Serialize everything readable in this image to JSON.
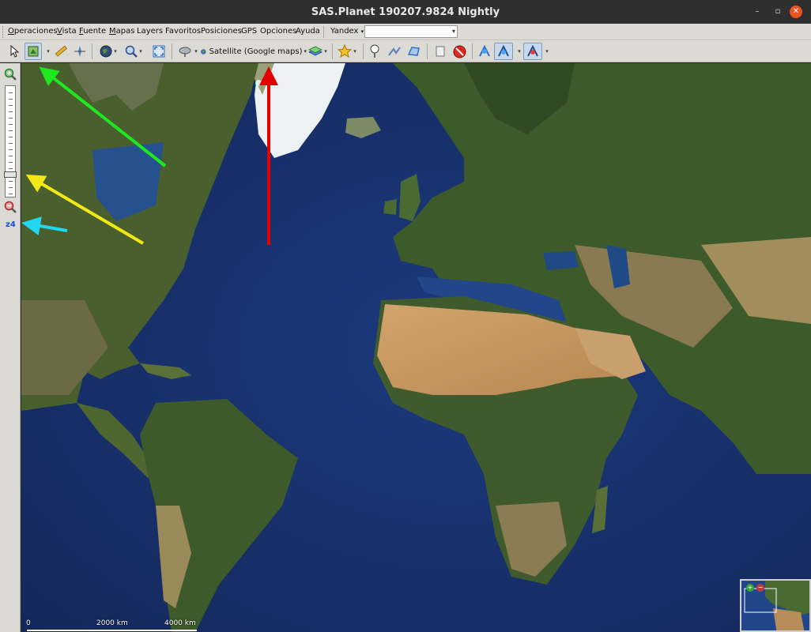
{
  "window": {
    "title": "SAS.Planet 190207.9824 Nightly",
    "minimize_glyph": "–",
    "maximize_glyph": "▫",
    "close_glyph": "✕"
  },
  "menu": {
    "items": [
      {
        "accel": "O",
        "rest": "peraciones"
      },
      {
        "accel": "V",
        "rest": "ista"
      },
      {
        "accel": "F",
        "rest": "uente"
      },
      {
        "accel": "M",
        "rest": "apas"
      },
      {
        "accel": "",
        "rest": "Layers"
      },
      {
        "accel": "",
        "rest": "Favoritos"
      },
      {
        "accel": "",
        "rest": "Posiciones"
      },
      {
        "accel": "",
        "rest": "GPS"
      },
      {
        "accel": "",
        "rest": "Opciones"
      },
      {
        "accel": "",
        "rest": "Ayuda"
      }
    ],
    "search_provider": "Yandex",
    "search_value": ""
  },
  "toolbar": {
    "map_source_label": "Satellite (Google maps)",
    "icons": [
      "cursor-icon",
      "select-region-icon",
      "ruler-icon",
      "compass-icon",
      "globe-icon",
      "zoom-lens-icon",
      "fullscreen-icon",
      "satellite-dish-icon",
      "map-source-globe-icon",
      "layers-icon",
      "favorite-star-icon",
      "placemark-icon",
      "path-icon",
      "polygon-icon",
      "label-icon",
      "stop-icon",
      "gps-connect-icon",
      "gps-track-icon",
      "gps-center-icon"
    ]
  },
  "leftpanel": {
    "zoom_level": "z4",
    "zoom_fraction": 0.82
  },
  "scalebar": {
    "labels": [
      "0",
      "2000 km",
      "4000 km"
    ]
  },
  "colors": {
    "ocean": "#1f3b7a",
    "land_green": "#3f5a2c",
    "desert": "#c59a63",
    "ice": "#f2f4f6",
    "arrow_red": "#e50000",
    "arrow_green": "#1ee81e",
    "arrow_yellow": "#f2e816",
    "arrow_cyan": "#22d8f0"
  }
}
